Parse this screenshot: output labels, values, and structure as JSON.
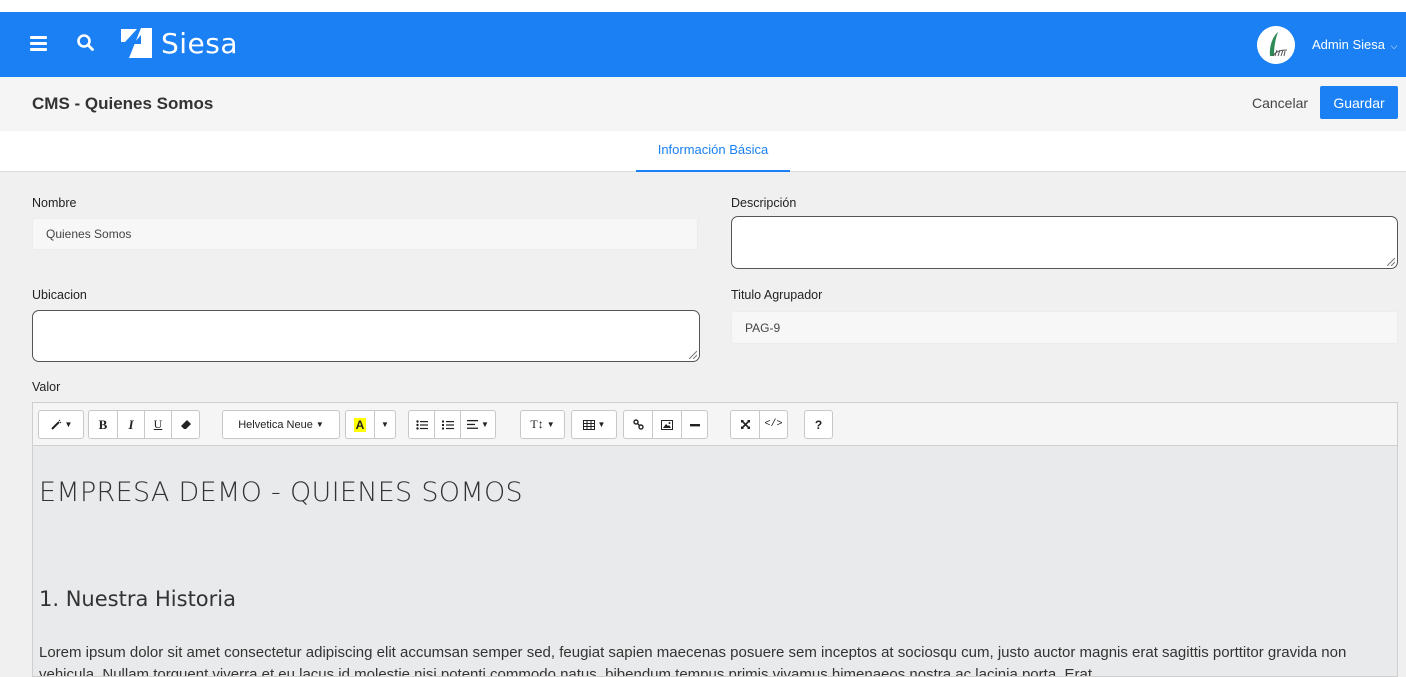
{
  "app": {
    "brand": "Siesa",
    "user_name": "Admin Siesa",
    "colors": {
      "primary": "#1a80f4",
      "background": "#f0f0f0"
    }
  },
  "header": {
    "title": "CMS - Quienes Somos",
    "cancel_label": "Cancelar",
    "save_label": "Guardar"
  },
  "tabs": [
    {
      "label": "Información Básica",
      "active": true
    }
  ],
  "form": {
    "nombre": {
      "label": "Nombre",
      "value": "Quienes Somos"
    },
    "descripcion": {
      "label": "Descripción",
      "value": ""
    },
    "ubicacion": {
      "label": "Ubicacion",
      "value": ""
    },
    "titulo_agrupador": {
      "label": "Titulo Agrupador",
      "value": "PAG-9"
    },
    "valor": {
      "label": "Valor"
    }
  },
  "editor": {
    "toolbar": {
      "font_name": "Helvetica Neue",
      "icons": [
        "magic-wand-icon",
        "bold-icon",
        "italic-icon",
        "underline-icon",
        "eraser-icon",
        "font-name-dropdown",
        "text-color-icon",
        "unordered-list-icon",
        "ordered-list-icon",
        "paragraph-align-icon",
        "line-height-icon",
        "table-icon",
        "link-icon",
        "picture-icon",
        "horizontal-rule-icon",
        "fullscreen-icon",
        "code-view-icon",
        "help-icon"
      ],
      "bold": "B",
      "italic": "I",
      "underline": "U",
      "color_letter": "A",
      "line_height": "T↕",
      "help": "?"
    },
    "content": {
      "heading": "EMPRESA DEMO - QUIENES SOMOS",
      "subheading": "1. Nuestra Historia",
      "paragraph": "Lorem ipsum dolor sit amet consectetur adipiscing elit accumsan semper sed, feugiat sapien maecenas posuere sem inceptos at sociosqu cum, justo auctor magnis erat sagittis porttitor gravida non vehicula. Nullam torquent viverra et eu lacus id molestie nisi potenti commodo natus, bibendum tempus primis vivamus himenaeos nostra ac lacinia porta. Erat"
    }
  }
}
